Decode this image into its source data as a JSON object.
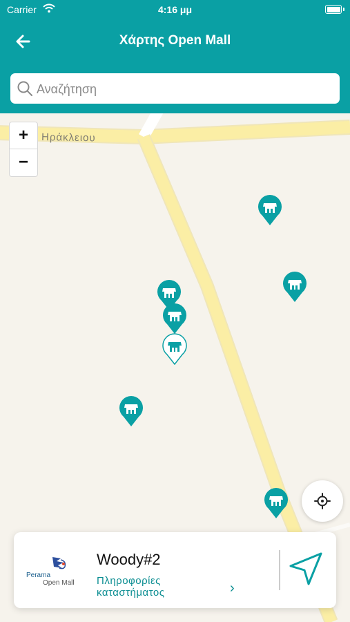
{
  "status_bar": {
    "carrier": "Carrier",
    "time": "4:16 μμ"
  },
  "header": {
    "title": "Χάρτης Open Mall"
  },
  "search": {
    "placeholder": "Αναζήτηση"
  },
  "map": {
    "street_label": "Ηράκλειου",
    "zoom_in": "+",
    "zoom_out": "−"
  },
  "store_card": {
    "logo_line1": "Perama",
    "logo_line2": "Open Mall",
    "name": "Woody#2",
    "info_link": "Πληροφορίες καταστήματος",
    "chevron": "›"
  },
  "colors": {
    "accent": "#0aa0a4",
    "map_bg": "#f6f3ec",
    "road": "#fbeea5"
  }
}
